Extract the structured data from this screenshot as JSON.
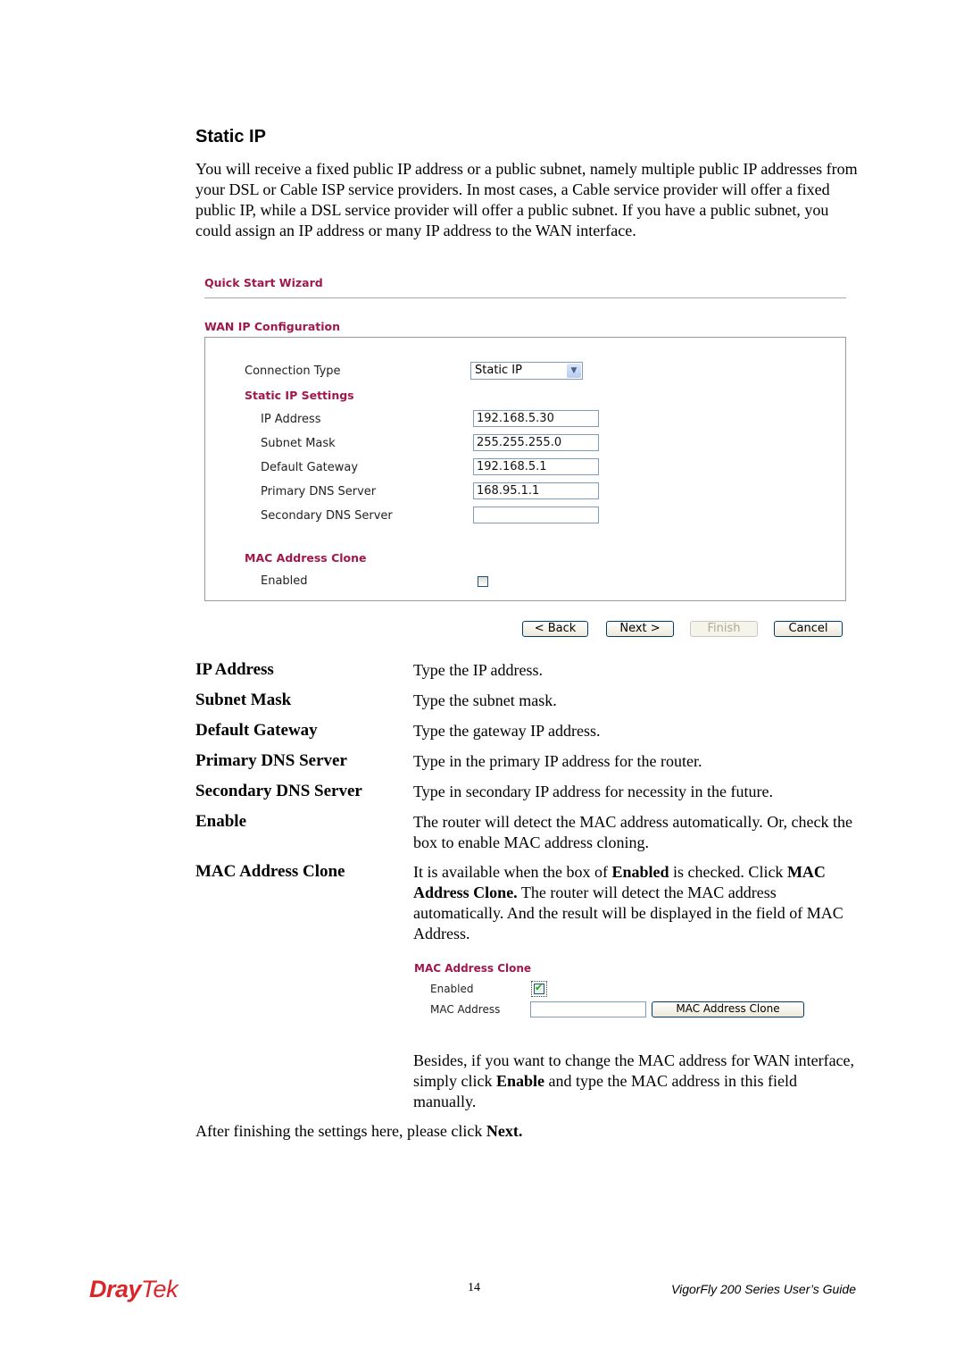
{
  "section_title": "Static IP",
  "intro": "You will receive a fixed public IP address or a public subnet, namely multiple public IP addresses from your DSL or Cable ISP service providers. In most cases, a Cable service provider will offer a fixed public IP, while a DSL service provider will offer a public subnet. If you have a public subnet, you could assign an IP address or many IP address to the WAN interface.",
  "wizard": {
    "title": "Quick Start Wizard",
    "section": "WAN IP Configuration",
    "connection_type_label": "Connection Type",
    "connection_type_value": "Static IP",
    "static_ip_settings": "Static IP Settings",
    "fields": [
      {
        "label": "IP Address",
        "value": "192.168.5.30"
      },
      {
        "label": "Subnet Mask",
        "value": "255.255.255.0"
      },
      {
        "label": "Default Gateway",
        "value": "192.168.5.1"
      },
      {
        "label": "Primary DNS Server",
        "value": "168.95.1.1"
      },
      {
        "label": "Secondary DNS Server",
        "value": ""
      }
    ],
    "mac_clone_heading": "MAC Address Clone",
    "enabled_label": "Enabled",
    "enabled_checked": false,
    "buttons": {
      "back": "< Back",
      "next": "Next >",
      "finish": "Finish",
      "cancel": "Cancel"
    }
  },
  "definitions": [
    {
      "term": "IP Address",
      "desc": "Type the IP address."
    },
    {
      "term": "Subnet Mask",
      "desc": "Type the subnet mask."
    },
    {
      "term": "Default Gateway",
      "desc": "Type the gateway IP address."
    },
    {
      "term": "Primary DNS Server",
      "desc": "Type in the primary IP address for the router."
    },
    {
      "term": "Secondary DNS Server",
      "desc": "Type in secondary IP address for necessity in the future."
    },
    {
      "term": "Enable",
      "desc": "The router will detect the MAC address automatically. Or, check the box to enable MAC address cloning."
    },
    {
      "term": "MAC Address Clone",
      "desc_parts": [
        "It is available when the box of ",
        "Enabled",
        " is checked. Click ",
        "MAC Address Clone.",
        " The router will detect the MAC address automatically. And the result will be displayed in the field of MAC Address."
      ]
    }
  ],
  "mac_panel": {
    "heading": "MAC Address Clone",
    "enabled_label": "Enabled",
    "enabled_checked": true,
    "mac_label": "MAC Address",
    "mac_value": "",
    "clone_button": "MAC Address Clone"
  },
  "besides_parts": [
    "Besides, if you want to change the MAC address for WAN interface, simply click ",
    "Enable",
    " and type the MAC address in this field manually."
  ],
  "closing_parts": [
    "After finishing the settings here, please click ",
    "Next."
  ],
  "footer": {
    "logo_a": "Dray",
    "logo_b": "Tek",
    "page_number": "14",
    "guide": "VigorFly 200 Series User’s Guide"
  }
}
